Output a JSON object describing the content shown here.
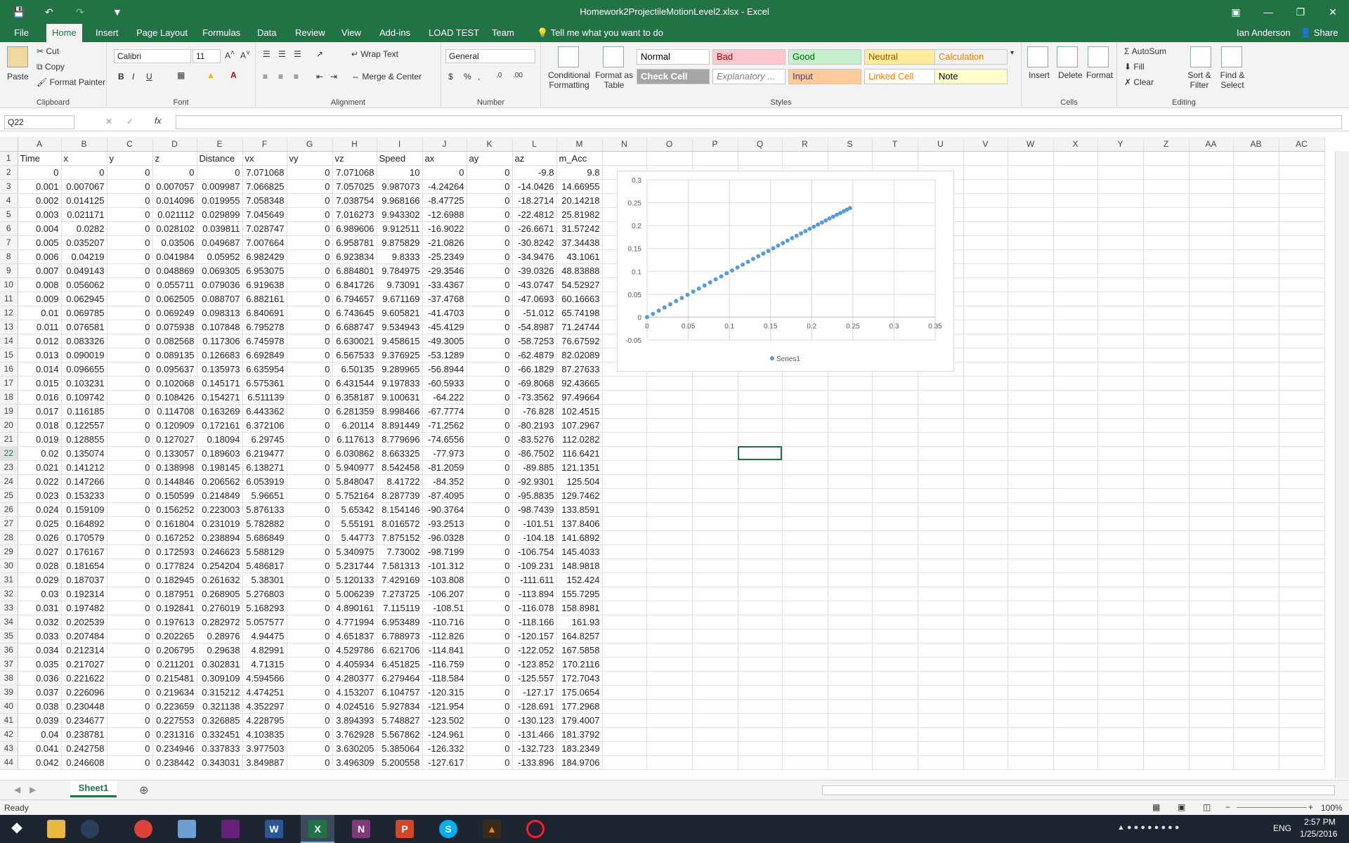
{
  "window": {
    "title": "Homework2ProjectileMotionLevel2.xlsx - Excel",
    "user": "Ian Anderson",
    "share": "Share"
  },
  "tabs": [
    "File",
    "Home",
    "Insert",
    "Page Layout",
    "Formulas",
    "Data",
    "Review",
    "View",
    "Add-ins",
    "LOAD TEST",
    "Team"
  ],
  "tell_me": "Tell me what you want to do",
  "ribbon": {
    "clipboard": {
      "paste": "Paste",
      "cut": "Cut",
      "copy": "Copy",
      "format_painter": "Format Painter",
      "label": "Clipboard"
    },
    "font": {
      "name": "Calibri",
      "size": "11",
      "label": "Font"
    },
    "alignment": {
      "wrap": "Wrap Text",
      "merge": "Merge & Center",
      "label": "Alignment"
    },
    "number": {
      "format": "General",
      "label": "Number"
    },
    "styles": {
      "conditional": "Conditional Formatting",
      "table": "Format as Table",
      "label": "Styles",
      "cells": [
        {
          "name": "Normal",
          "bg": "#ffffff",
          "fg": "#000000"
        },
        {
          "name": "Bad",
          "bg": "#ffc7ce",
          "fg": "#9c0006"
        },
        {
          "name": "Good",
          "bg": "#c6efce",
          "fg": "#006100"
        },
        {
          "name": "Neutral",
          "bg": "#ffeb9c",
          "fg": "#9c5700"
        },
        {
          "name": "Calculation",
          "bg": "#f2f2f2",
          "fg": "#fa7d00"
        },
        {
          "name": "Check Cell",
          "bg": "#a5a5a5",
          "fg": "#ffffff"
        },
        {
          "name": "Explanatory ...",
          "bg": "#ffffff",
          "fg": "#7f7f7f"
        },
        {
          "name": "Input",
          "bg": "#ffcc99",
          "fg": "#3f3f76"
        },
        {
          "name": "Linked Cell",
          "bg": "#ffffff",
          "fg": "#fa7d00"
        },
        {
          "name": "Note",
          "bg": "#ffffcc",
          "fg": "#000000"
        }
      ]
    },
    "cells": {
      "insert": "Insert",
      "delete": "Delete",
      "format": "Format",
      "label": "Cells"
    },
    "editing": {
      "autosum": "AutoSum",
      "fill": "Fill",
      "clear": "Clear",
      "sort": "Sort & Filter",
      "find": "Find & Select",
      "label": "Editing"
    }
  },
  "formula_bar": {
    "name_box": "Q22",
    "content": "",
    "fx": "fx"
  },
  "columns": [
    "A",
    "B",
    "C",
    "D",
    "E",
    "F",
    "G",
    "H",
    "I",
    "J",
    "K",
    "L",
    "M",
    "N",
    "O",
    "P",
    "Q",
    "R",
    "S",
    "T",
    "U",
    "V",
    "W",
    "X",
    "Y",
    "Z",
    "AA",
    "AB",
    "AC"
  ],
  "headers": [
    "Time",
    "x",
    "y",
    "z",
    "Distance",
    "vx",
    "vy",
    "vz",
    "Speed",
    "ax",
    "ay",
    "az",
    "m_Acc"
  ],
  "rows": [
    [
      "0",
      "0",
      "0",
      "0",
      "0",
      "7.071068",
      "0",
      "7.071068",
      "10",
      "0",
      "0",
      "-9.8",
      "9.8"
    ],
    [
      "0.001",
      "0.007067",
      "0",
      "0.007057",
      "0.009987",
      "7.066825",
      "0",
      "7.057025",
      "9.987073",
      "-4.24264",
      "0",
      "-14.0426",
      "14.66955"
    ],
    [
      "0.002",
      "0.014125",
      "0",
      "0.014096",
      "0.019955",
      "7.058348",
      "0",
      "7.038754",
      "9.968166",
      "-8.47725",
      "0",
      "-18.2714",
      "20.14218"
    ],
    [
      "0.003",
      "0.021171",
      "0",
      "0.021112",
      "0.029899",
      "7.045649",
      "0",
      "7.016273",
      "9.943302",
      "-12.6988",
      "0",
      "-22.4812",
      "25.81982"
    ],
    [
      "0.004",
      "0.0282",
      "0",
      "0.028102",
      "0.039811",
      "7.028747",
      "0",
      "6.989606",
      "9.912511",
      "-16.9022",
      "0",
      "-26.6671",
      "31.57242"
    ],
    [
      "0.005",
      "0.035207",
      "0",
      "0.03506",
      "0.049687",
      "7.007664",
      "0",
      "6.958781",
      "9.875829",
      "-21.0826",
      "0",
      "-30.8242",
      "37.34438"
    ],
    [
      "0.006",
      "0.04219",
      "0",
      "0.041984",
      "0.05952",
      "6.982429",
      "0",
      "6.923834",
      "9.8333",
      "-25.2349",
      "0",
      "-34.9476",
      "43.1061"
    ],
    [
      "0.007",
      "0.049143",
      "0",
      "0.048869",
      "0.069305",
      "6.953075",
      "0",
      "6.884801",
      "9.784975",
      "-29.3546",
      "0",
      "-39.0326",
      "48.83888"
    ],
    [
      "0.008",
      "0.056062",
      "0",
      "0.055711",
      "0.079036",
      "6.919638",
      "0",
      "6.841726",
      "9.73091",
      "-33.4367",
      "0",
      "-43.0747",
      "54.52927"
    ],
    [
      "0.009",
      "0.062945",
      "0",
      "0.062505",
      "0.088707",
      "6.882161",
      "0",
      "6.794657",
      "9.671169",
      "-37.4768",
      "0",
      "-47.0693",
      "60.16663"
    ],
    [
      "0.01",
      "0.069785",
      "0",
      "0.069249",
      "0.098313",
      "6.840691",
      "0",
      "6.743645",
      "9.605821",
      "-41.4703",
      "0",
      "-51.012",
      "65.74198"
    ],
    [
      "0.011",
      "0.076581",
      "0",
      "0.075938",
      "0.107848",
      "6.795278",
      "0",
      "6.688747",
      "9.534943",
      "-45.4129",
      "0",
      "-54.8987",
      "71.24744"
    ],
    [
      "0.012",
      "0.083326",
      "0",
      "0.082568",
      "0.117306",
      "6.745978",
      "0",
      "6.630021",
      "9.458615",
      "-49.3005",
      "0",
      "-58.7253",
      "76.67592"
    ],
    [
      "0.013",
      "0.090019",
      "0",
      "0.089135",
      "0.126683",
      "6.692849",
      "0",
      "6.567533",
      "9.376925",
      "-53.1289",
      "0",
      "-62.4879",
      "82.02089"
    ],
    [
      "0.014",
      "0.096655",
      "0",
      "0.095637",
      "0.135973",
      "6.635954",
      "0",
      "6.50135",
      "9.289965",
      "-56.8944",
      "0",
      "-66.1829",
      "87.27633"
    ],
    [
      "0.015",
      "0.103231",
      "0",
      "0.102068",
      "0.145171",
      "6.575361",
      "0",
      "6.431544",
      "9.197833",
      "-60.5933",
      "0",
      "-69.8068",
      "92.43665"
    ],
    [
      "0.016",
      "0.109742",
      "0",
      "0.108426",
      "0.154271",
      "6.511139",
      "0",
      "6.358187",
      "9.100631",
      "-64.222",
      "0",
      "-73.3562",
      "97.49664"
    ],
    [
      "0.017",
      "0.116185",
      "0",
      "0.114708",
      "0.163269",
      "6.443362",
      "0",
      "6.281359",
      "8.998466",
      "-67.7774",
      "0",
      "-76.828",
      "102.4515"
    ],
    [
      "0.018",
      "0.122557",
      "0",
      "0.120909",
      "0.172161",
      "6.372106",
      "0",
      "6.20114",
      "8.891449",
      "-71.2562",
      "0",
      "-80.2193",
      "107.2967"
    ],
    [
      "0.019",
      "0.128855",
      "0",
      "0.127027",
      "0.18094",
      "6.29745",
      "0",
      "6.117613",
      "8.779696",
      "-74.6556",
      "0",
      "-83.5276",
      "112.0282"
    ],
    [
      "0.02",
      "0.135074",
      "0",
      "0.133057",
      "0.189603",
      "6.219477",
      "0",
      "6.030862",
      "8.663325",
      "-77.973",
      "0",
      "-86.7502",
      "116.6421"
    ],
    [
      "0.021",
      "0.141212",
      "0",
      "0.138998",
      "0.198145",
      "6.138271",
      "0",
      "5.940977",
      "8.542458",
      "-81.2059",
      "0",
      "-89.885",
      "121.1351"
    ],
    [
      "0.022",
      "0.147266",
      "0",
      "0.144846",
      "0.206562",
      "6.053919",
      "0",
      "5.848047",
      "8.41722",
      "-84.352",
      "0",
      "-92.9301",
      "125.504"
    ],
    [
      "0.023",
      "0.153233",
      "0",
      "0.150599",
      "0.214849",
      "5.96651",
      "0",
      "5.752164",
      "8.287739",
      "-87.4095",
      "0",
      "-95.8835",
      "129.7462"
    ],
    [
      "0.024",
      "0.159109",
      "0",
      "0.156252",
      "0.223003",
      "5.876133",
      "0",
      "5.65342",
      "8.154146",
      "-90.3764",
      "0",
      "-98.7439",
      "133.8591"
    ],
    [
      "0.025",
      "0.164892",
      "0",
      "0.161804",
      "0.231019",
      "5.782882",
      "0",
      "5.55191",
      "8.016572",
      "-93.2513",
      "0",
      "-101.51",
      "137.8406"
    ],
    [
      "0.026",
      "0.170579",
      "0",
      "0.167252",
      "0.238894",
      "5.686849",
      "0",
      "5.44773",
      "7.875152",
      "-96.0328",
      "0",
      "-104.18",
      "141.6892"
    ],
    [
      "0.027",
      "0.176167",
      "0",
      "0.172593",
      "0.246623",
      "5.588129",
      "0",
      "5.340975",
      "7.73002",
      "-98.7199",
      "0",
      "-106.754",
      "145.4033"
    ],
    [
      "0.028",
      "0.181654",
      "0",
      "0.177824",
      "0.254204",
      "5.486817",
      "0",
      "5.231744",
      "7.581313",
      "-101.312",
      "0",
      "-109.231",
      "148.9818"
    ],
    [
      "0.029",
      "0.187037",
      "0",
      "0.182945",
      "0.261632",
      "5.38301",
      "0",
      "5.120133",
      "7.429169",
      "-103.808",
      "0",
      "-111.611",
      "152.424"
    ],
    [
      "0.03",
      "0.192314",
      "0",
      "0.187951",
      "0.268905",
      "5.276803",
      "0",
      "5.006239",
      "7.273725",
      "-106.207",
      "0",
      "-113.894",
      "155.7295"
    ],
    [
      "0.031",
      "0.197482",
      "0",
      "0.192841",
      "0.276019",
      "5.168293",
      "0",
      "4.890161",
      "7.115119",
      "-108.51",
      "0",
      "-116.078",
      "158.8981"
    ],
    [
      "0.032",
      "0.202539",
      "0",
      "0.197613",
      "0.282972",
      "5.057577",
      "0",
      "4.771994",
      "6.953489",
      "-110.716",
      "0",
      "-118.166",
      "161.93"
    ],
    [
      "0.033",
      "0.207484",
      "0",
      "0.202265",
      "0.28976",
      "4.94475",
      "0",
      "4.651837",
      "6.788973",
      "-112.826",
      "0",
      "-120.157",
      "164.8257"
    ],
    [
      "0.034",
      "0.212314",
      "0",
      "0.206795",
      "0.29638",
      "4.82991",
      "0",
      "4.529786",
      "6.621706",
      "-114.841",
      "0",
      "-122.052",
      "167.5858"
    ],
    [
      "0.035",
      "0.217027",
      "0",
      "0.211201",
      "0.302831",
      "4.71315",
      "0",
      "4.405934",
      "6.451825",
      "-116.759",
      "0",
      "-123.852",
      "170.2116"
    ],
    [
      "0.036",
      "0.221622",
      "0",
      "0.215481",
      "0.309109",
      "4.594566",
      "0",
      "4.280377",
      "6.279464",
      "-118.584",
      "0",
      "-125.557",
      "172.7043"
    ],
    [
      "0.037",
      "0.226096",
      "0",
      "0.219634",
      "0.315212",
      "4.474251",
      "0",
      "4.153207",
      "6.104757",
      "-120.315",
      "0",
      "-127.17",
      "175.0654"
    ],
    [
      "0.038",
      "0.230448",
      "0",
      "0.223659",
      "0.321138",
      "4.352297",
      "0",
      "4.024516",
      "5.927834",
      "-121.954",
      "0",
      "-128.691",
      "177.2968"
    ],
    [
      "0.039",
      "0.234677",
      "0",
      "0.227553",
      "0.326885",
      "4.228795",
      "0",
      "3.894393",
      "5.748827",
      "-123.502",
      "0",
      "-130.123",
      "179.4007"
    ],
    [
      "0.04",
      "0.238781",
      "0",
      "0.231316",
      "0.332451",
      "4.103835",
      "0",
      "3.762928",
      "5.567862",
      "-124.961",
      "0",
      "-131.466",
      "181.3792"
    ],
    [
      "0.041",
      "0.242758",
      "0",
      "0.234946",
      "0.337833",
      "3.977503",
      "0",
      "3.630205",
      "5.385064",
      "-126.332",
      "0",
      "-132.723",
      "183.2349"
    ],
    [
      "0.042",
      "0.246608",
      "0",
      "0.238442",
      "0.343031",
      "3.849887",
      "0",
      "3.496309",
      "5.200558",
      "-127.617",
      "0",
      "-133.896",
      "184.9706"
    ]
  ],
  "chart_data": {
    "type": "scatter",
    "series": [
      {
        "name": "Series1",
        "x_from_column": "x",
        "y_from_column": "z",
        "color": "#5b9bd5"
      }
    ],
    "xlim": [
      0,
      0.35
    ],
    "ylim": [
      -0.05,
      0.3
    ],
    "xticks": [
      "0",
      "0.05",
      "0.1",
      "0.15",
      "0.2",
      "0.25",
      "0.3",
      "0.35"
    ],
    "yticks": [
      "0.3",
      "0.25",
      "0.2",
      "0.15",
      "0.1",
      "0.05",
      "0",
      "-0.05"
    ],
    "grid": true,
    "legend": "bottom"
  },
  "sheet_tab": "Sheet1",
  "status": {
    "ready": "Ready",
    "zoom": "100%"
  },
  "taskbar": {
    "time": "2:57 PM",
    "date": "1/25/2016",
    "lang": "ENG"
  }
}
